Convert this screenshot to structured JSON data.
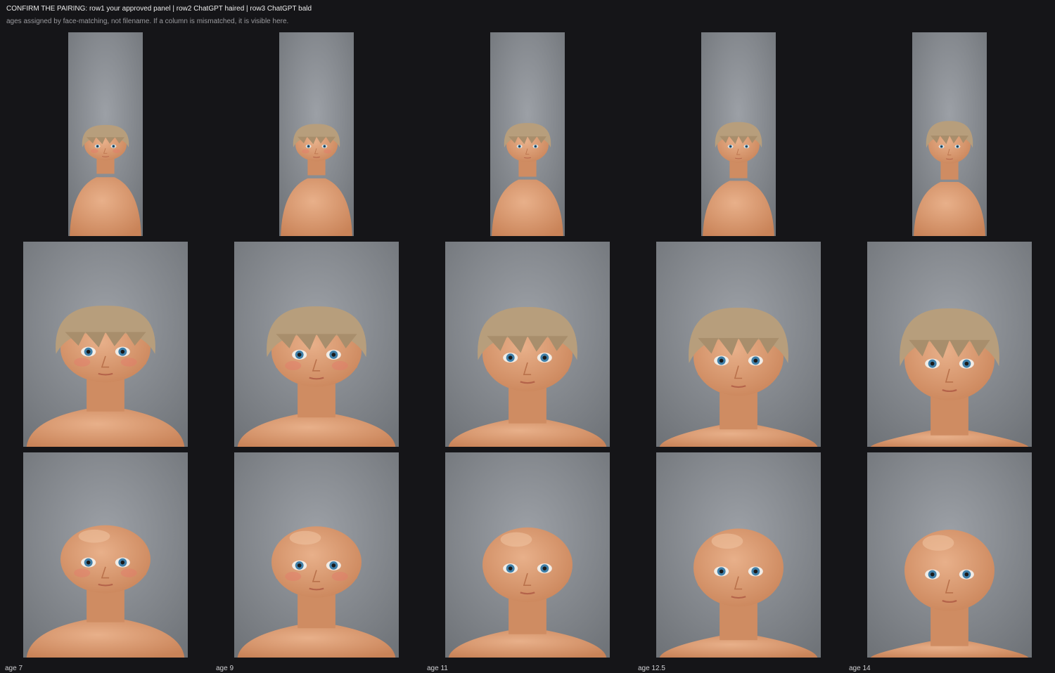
{
  "header": {
    "title": "CONFIRM THE PAIRING:  row1 your approved panel  |  row2 ChatGPT haired  |  row3 ChatGPT bald",
    "subtitle": "ages assigned by face-matching, not filename. If a column is mismatched, it is visible here."
  },
  "columns": [
    {
      "age_label": "age 7"
    },
    {
      "age_label": "age 9"
    },
    {
      "age_label": "age 11"
    },
    {
      "age_label": "age 12.5"
    },
    {
      "age_label": "age 14"
    }
  ],
  "colors": {
    "background": "#151518",
    "photo_backdrop": "#8d9196",
    "skin": "#d99a72",
    "ear": "#e47b4c",
    "hair": "#b79e7c",
    "eyes": "#3f7fa8"
  }
}
